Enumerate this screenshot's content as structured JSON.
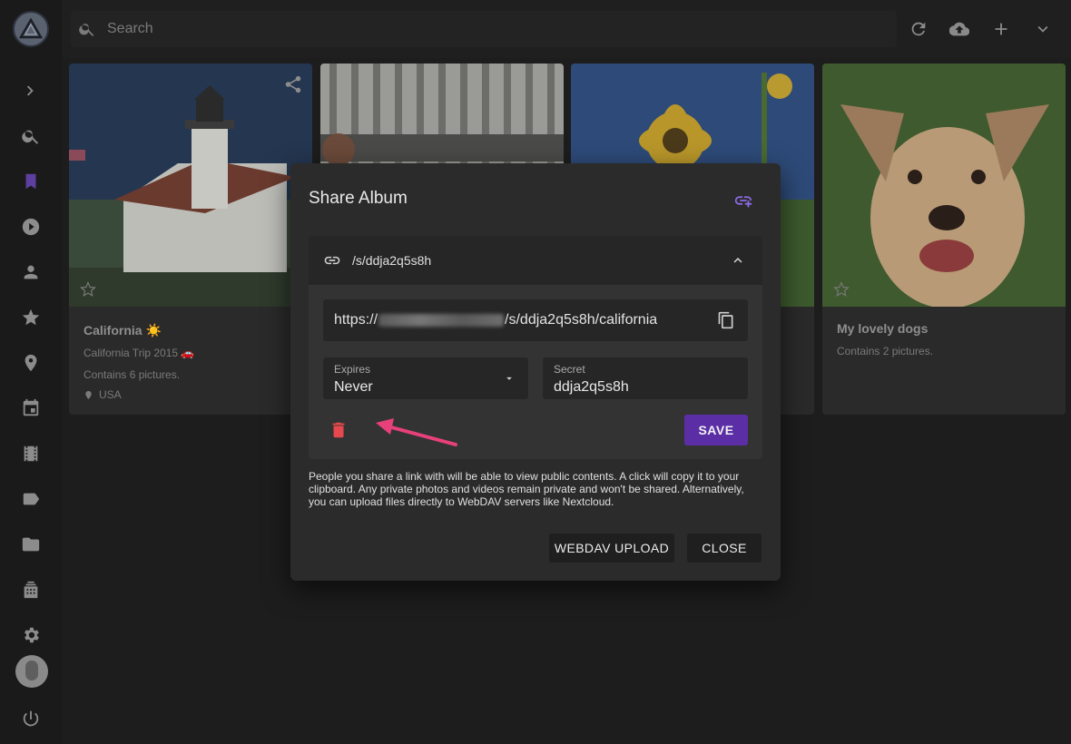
{
  "search": {
    "placeholder": "Search"
  },
  "cards": [
    {
      "title": "California ☀️",
      "subtitle": "California Trip 2015 🚗",
      "count": "Contains 6 pictures.",
      "location": "USA"
    },
    {
      "title": "",
      "subtitle": "",
      "count": "",
      "location": ""
    },
    {
      "title": "",
      "subtitle": "",
      "count": "",
      "location": ""
    },
    {
      "title": "My lovely dogs",
      "subtitle": "",
      "count": "Contains 2 pictures.",
      "location": ""
    }
  ],
  "dialog": {
    "title": "Share Album",
    "link_label": "/s/ddja2q5s8h",
    "url_prefix": "https://",
    "url_suffix": "/s/ddja2q5s8h/california",
    "expires_label": "Expires",
    "expires_value": "Never",
    "secret_label": "Secret",
    "secret_value": "ddja2q5s8h",
    "save_label": "SAVE",
    "info_text": "People you share a link with will be able to view public contents. A click will copy it to your clipboard. Any private photos and videos remain private and won't be shared. Alternatively, you can upload files directly to WebDAV servers like Nextcloud.",
    "webdav_label": "WEBDAV UPLOAD",
    "close_label": "CLOSE"
  },
  "colors": {
    "accent": "#5b2ea6",
    "accent_icon": "#8f6be8",
    "delete": "#e5484d",
    "annotation_arrow": "#e8407a"
  },
  "icons": {
    "sidebar": [
      "chevron-right-icon",
      "search-icon",
      "bookmark-icon",
      "play-icon",
      "person-icon",
      "star-icon",
      "place-icon",
      "calendar-icon",
      "film-icon",
      "label-icon",
      "folder-icon",
      "album-stack-icon",
      "gear-icon",
      "power-icon"
    ],
    "toolbar": [
      "refresh-icon",
      "cloud-upload-icon",
      "plus-icon",
      "chevron-down-icon"
    ]
  }
}
